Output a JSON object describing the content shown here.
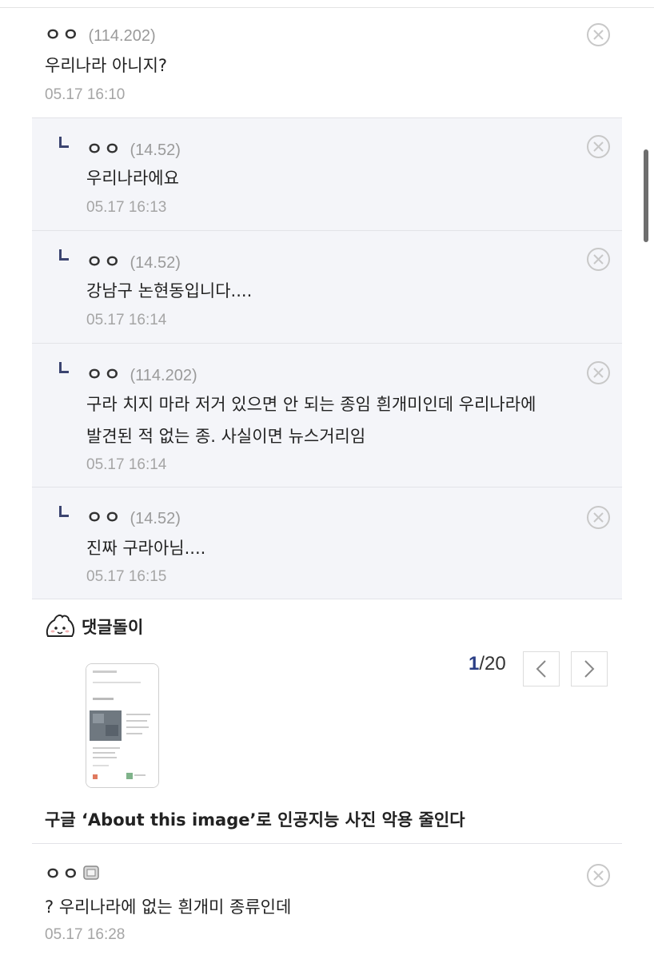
{
  "comments": [
    {
      "author": "ㅇㅇ",
      "ip": "(114.202)",
      "text": "우리나라 아니지?",
      "date": "05.17 16:10"
    },
    {
      "author": "ㅇㅇ",
      "ip": "(14.52)",
      "text": "우리나라에요",
      "date": "05.17 16:13"
    },
    {
      "author": "ㅇㅇ",
      "ip": "(14.52)",
      "text": "강남구 논현동입니다....",
      "date": "05.17 16:14"
    },
    {
      "author": "ㅇㅇ",
      "ip": "(114.202)",
      "text_line1": "구라 치지 마라 저거 있으면 안 되는 종임 흰개미인데 우리나라에",
      "text_line2": "발견된 적 없는 종. 사실이면 뉴스거리임",
      "date": "05.17 16:14"
    },
    {
      "author": "ㅇㅇ",
      "ip": "(14.52)",
      "text": "진짜 구라아님....",
      "date": "05.17 16:15"
    },
    {
      "author": "ㅇㅇ",
      "text": "? 우리나라에 없는 흰개미 종류인데",
      "date": "05.17 16:28"
    }
  ],
  "bot": {
    "title": "댓글돌이",
    "icon": "dumpling-mascot-icon"
  },
  "pager": {
    "current": "1",
    "total": "/20"
  },
  "news": {
    "title": "구글 ‘About this image’로 인공지능 사진 악용 줄인다"
  },
  "colors": {
    "reply_bg": "#f4f5f9",
    "pager_accent": "#2b3f86",
    "reply_mark": "#3b4470"
  }
}
